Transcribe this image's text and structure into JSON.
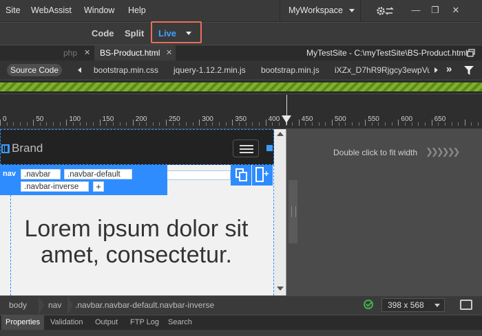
{
  "menu": {
    "items": [
      "Site",
      "WebAssist",
      "Window",
      "Help"
    ],
    "workspace": "MyWorkspace"
  },
  "view_switch": {
    "code": "Code",
    "split": "Split",
    "live": "Live"
  },
  "doc_tabs": {
    "prev_tab": "php",
    "active_tab": "BS-Product.html",
    "path": "MyTestSite - C:\\myTestSite\\BS-Product.html"
  },
  "related_files": {
    "source_code": "Source Code",
    "files": [
      "bootstrap.min.css",
      "jquery-1.12.2.min.js",
      "bootstrap.min.js",
      "iXZx_D7hR9Rjgcy3ewpVu"
    ]
  },
  "ruler": {
    "labels": [
      "0",
      "50",
      "100",
      "150",
      "200",
      "250",
      "300",
      "350",
      "400",
      "450",
      "500",
      "550",
      "600",
      "650"
    ]
  },
  "live_view": {
    "brand": "Brand",
    "hud": {
      "tag": "nav",
      "classes": [
        ".navbar",
        ".navbar-default",
        ".navbar-inverse"
      ],
      "add": "+"
    },
    "heading": "Lorem ipsum dolor sit amet, consectetur."
  },
  "fit_hint": "Double click to fit width",
  "tag_selector": {
    "crumbs": [
      "body",
      "nav",
      ".navbar.navbar-default.navbar-inverse"
    ],
    "viewport_size": "398 x 568"
  },
  "panel_tabs": [
    "Properties",
    "Validation",
    "Output",
    "FTP Log",
    "Search"
  ],
  "colors": {
    "accent_live": "#3ea3ff",
    "highlight_box": "#e8705a",
    "media_query_bar": "#7fb02a",
    "selection": "#2f8cff"
  }
}
